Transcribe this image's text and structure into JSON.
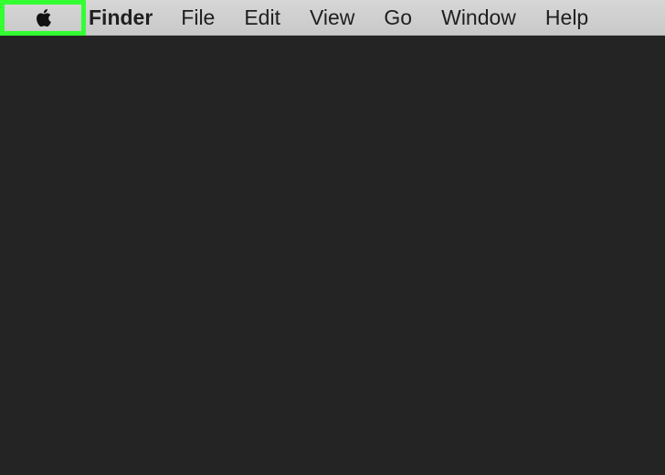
{
  "menubar": {
    "apple_icon": "apple-logo-icon",
    "app_name": "Finder",
    "items": [
      {
        "label": "File"
      },
      {
        "label": "Edit"
      },
      {
        "label": "View"
      },
      {
        "label": "Go"
      },
      {
        "label": "Window"
      },
      {
        "label": "Help"
      }
    ]
  },
  "highlight": {
    "target": "apple-menu",
    "color": "#33ff33"
  },
  "colors": {
    "menubar_bg": "#d0d0d0",
    "desktop_bg": "#242424"
  }
}
